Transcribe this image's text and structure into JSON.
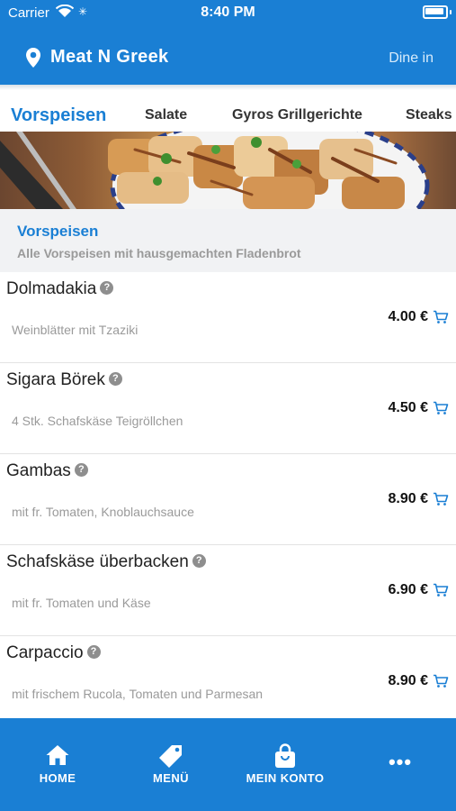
{
  "status_bar": {
    "carrier": "Carrier",
    "time": "8:40 PM"
  },
  "header": {
    "store_name": "Meat N Greek",
    "mode": "Dine in"
  },
  "tabs": [
    "Vorspeisen",
    "Salate",
    "Gyros Grillgerichte",
    "Steaks"
  ],
  "category": {
    "title": "Vorspeisen",
    "subtitle": "Alle Vorspeisen mit hausgemachten Fladenbrot"
  },
  "items": [
    {
      "name": "Dolmadakia",
      "description": "Weinblätter mit Tzaziki",
      "price": "4.00 €"
    },
    {
      "name": "Sigara Börek",
      "description": "4 Stk. Schafskäse Teigröllchen",
      "price": "4.50 €"
    },
    {
      "name": "Gambas",
      "description": "mit fr. Tomaten, Knoblauchsauce",
      "price": "8.90 €"
    },
    {
      "name": "Schafskäse überbacken",
      "description": "mit fr. Tomaten und Käse",
      "price": "6.90 €"
    },
    {
      "name": "Carpaccio",
      "description": "mit frischem Rucola, Tomaten und Parmesan",
      "price": "8.90 €"
    }
  ],
  "info_badge": "?",
  "bottom_nav": {
    "home": "HOME",
    "menu": "MENÜ",
    "account": "MEIN KONTO",
    "more": "•••"
  },
  "colors": {
    "primary": "#1a7fd4",
    "text": "#222222",
    "muted": "#9a9a9a",
    "category_bg": "#f1f2f4"
  }
}
